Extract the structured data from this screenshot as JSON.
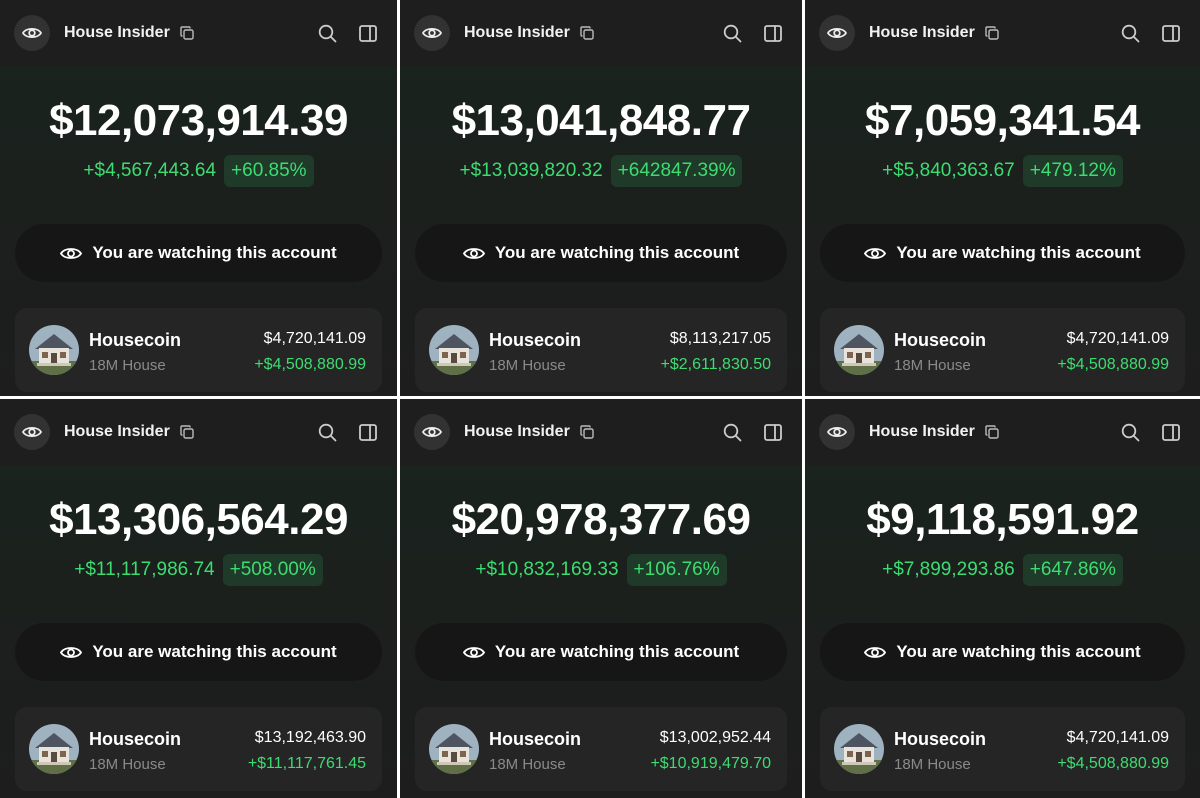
{
  "colors": {
    "background": "#1e1e1e",
    "positive": "#3ddc71",
    "pill_background": "#1f3a29",
    "button_background": "#161616",
    "card_background": "#252525"
  },
  "panels": [
    {
      "app_title": "House Insider",
      "balance": "$12,073,914.39",
      "change_abs": "+$4,567,443.64",
      "change_pct": "+60.85%",
      "watch_label": "You are watching this account",
      "holding": {
        "name": "Housecoin",
        "sub": "18M House",
        "value": "$4,720,141.09",
        "gain": "+$4,508,880.99"
      }
    },
    {
      "app_title": "House Insider",
      "balance": "$13,041,848.77",
      "change_abs": "+$13,039,820.32",
      "change_pct": "+642847.39%",
      "watch_label": "You are watching this account",
      "holding": {
        "name": "Housecoin",
        "sub": "18M House",
        "value": "$8,113,217.05",
        "gain": "+$2,611,830.50"
      }
    },
    {
      "app_title": "House Insider",
      "balance": "$7,059,341.54",
      "change_abs": "+$5,840,363.67",
      "change_pct": "+479.12%",
      "watch_label": "You are watching this account",
      "holding": {
        "name": "Housecoin",
        "sub": "18M House",
        "value": "$4,720,141.09",
        "gain": "+$4,508,880.99"
      }
    },
    {
      "app_title": "House Insider",
      "balance": "$13,306,564.29",
      "change_abs": "+$11,117,986.74",
      "change_pct": "+508.00%",
      "watch_label": "You are watching this account",
      "holding": {
        "name": "Housecoin",
        "sub": "18M House",
        "value": "$13,192,463.90",
        "gain": "+$11,117,761.45"
      }
    },
    {
      "app_title": "House Insider",
      "balance": "$20,978,377.69",
      "change_abs": "+$10,832,169.33",
      "change_pct": "+106.76%",
      "watch_label": "You are watching this account",
      "holding": {
        "name": "Housecoin",
        "sub": "18M House",
        "value": "$13,002,952.44",
        "gain": "+$10,919,479.70"
      }
    },
    {
      "app_title": "House Insider",
      "balance": "$9,118,591.92",
      "change_abs": "+$7,899,293.86",
      "change_pct": "+647.86%",
      "watch_label": "You are watching this account",
      "holding": {
        "name": "Housecoin",
        "sub": "18M House",
        "value": "$4,720,141.09",
        "gain": "+$4,508,880.99"
      }
    }
  ]
}
